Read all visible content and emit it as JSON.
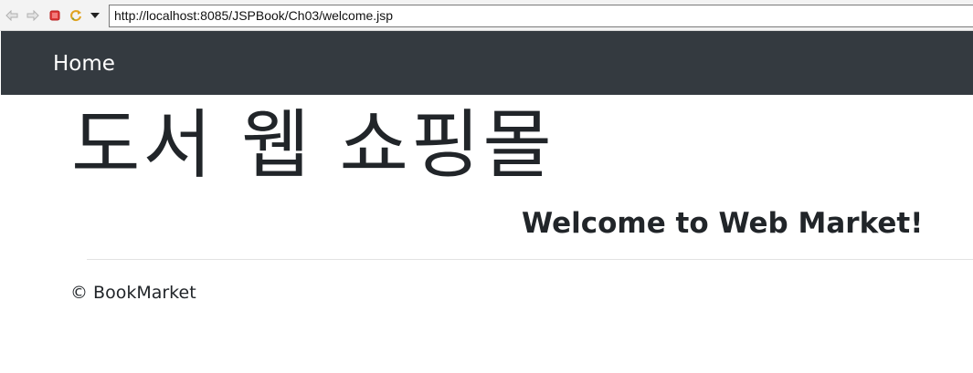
{
  "browser": {
    "address_url": "http://localhost:8085/JSPBook/Ch03/welcome.jsp",
    "icons": [
      "back-arrow-icon",
      "forward-arrow-icon",
      "stop-icon",
      "refresh-icon",
      "dropdown-arrow-icon"
    ]
  },
  "navbar": {
    "brand_label": "Home",
    "background": "#343a40",
    "text_color": "#ffffff"
  },
  "hero": {
    "title": "도서 웹 쇼핑몰",
    "subtitle": "Welcome to Web Market!"
  },
  "footer": {
    "text": "© BookMarket"
  }
}
